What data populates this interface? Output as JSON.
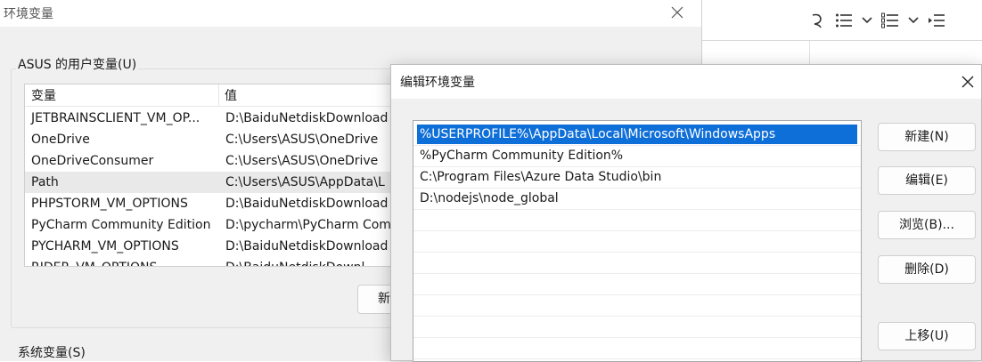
{
  "env_window": {
    "title": "环境变量",
    "user_group_label": "ASUS 的用户变量(U)",
    "columns": {
      "variable": "变量",
      "value": "值"
    },
    "user_vars": [
      {
        "name": "JETBRAINSCLIENT_VM_OP...",
        "value": "D:\\BaiduNetdiskDownload"
      },
      {
        "name": "OneDrive",
        "value": "C:\\Users\\ASUS\\OneDrive"
      },
      {
        "name": "OneDriveConsumer",
        "value": "C:\\Users\\ASUS\\OneDrive"
      },
      {
        "name": "Path",
        "value": "C:\\Users\\ASUS\\AppData\\L"
      },
      {
        "name": "PHPSTORM_VM_OPTIONS",
        "value": "D:\\BaiduNetdiskDownload"
      },
      {
        "name": "PyCharm Community Edition",
        "value": "D:\\pycharm\\PyCharm Com"
      },
      {
        "name": "PYCHARM_VM_OPTIONS",
        "value": "D:\\BaiduNetdiskDownload"
      },
      {
        "name": "RIDER_VM_OPTIONS",
        "value": "D:\\BaiduNetdiskDownl"
      }
    ],
    "selected_user_var": "Path",
    "new_button_partial": "新",
    "system_group_label": "系统变量(S)"
  },
  "edit_dialog": {
    "title": "编辑环境变量",
    "paths": [
      "%USERPROFILE%\\AppData\\Local\\Microsoft\\WindowsApps",
      "%PyCharm Community Edition%",
      "C:\\Program Files\\Azure Data Studio\\bin",
      "D:\\nodejs\\node_global"
    ],
    "selected_path_index": 0,
    "buttons": {
      "new": "新建(N)",
      "edit": "编辑(E)",
      "browse": "浏览(B)...",
      "delete": "删除(D)",
      "move_up": "上移(U)"
    }
  },
  "colors": {
    "selection_blue": "#0f6fd8",
    "window_bg": "#f0f0f0"
  },
  "icons": {
    "env_close": "close-icon",
    "dialog_close": "close-icon",
    "toolbar": [
      "partial-glyph-icon",
      "bullet-list-icon",
      "chevron-down-icon",
      "numbered-list-icon",
      "chevron-down-icon",
      "indent-icon"
    ]
  }
}
